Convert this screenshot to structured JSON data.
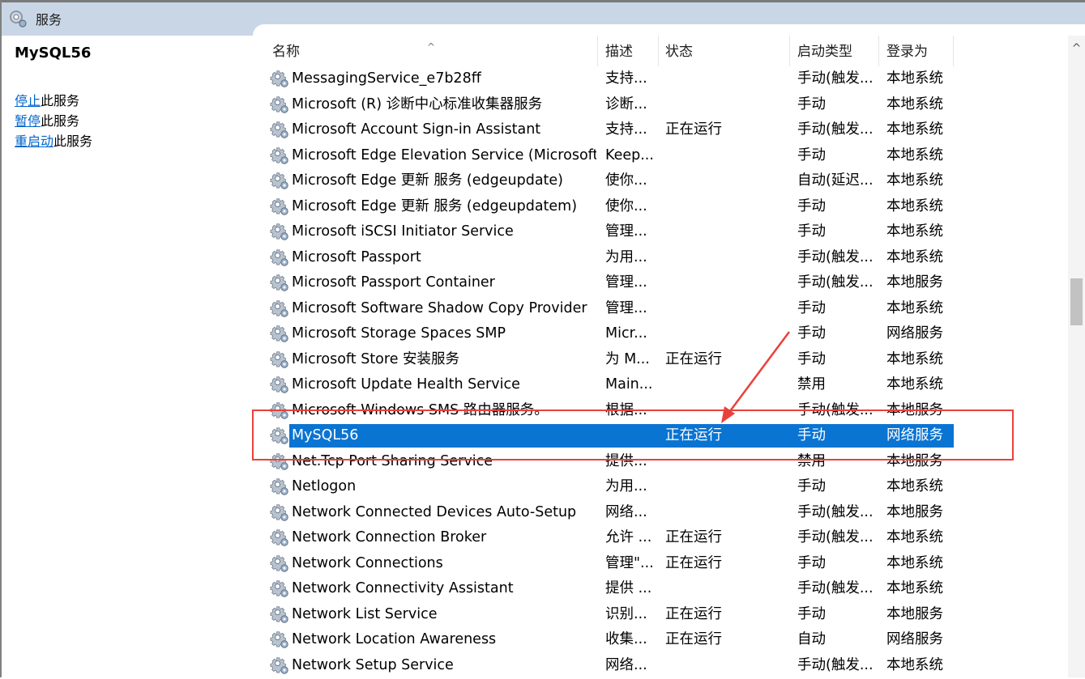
{
  "window": {
    "title": "服务"
  },
  "left_pane": {
    "service_name": "MySQL56",
    "actions": [
      {
        "link": "停止",
        "suffix": "此服务"
      },
      {
        "link": "暂停",
        "suffix": "此服务"
      },
      {
        "link": "重启动",
        "suffix": "此服务"
      }
    ]
  },
  "columns": {
    "name": "名称",
    "description": "描述",
    "status": "状态",
    "startup_type": "启动类型",
    "logon_as": "登录为"
  },
  "services": [
    {
      "name": "MessagingService_e7b28ff",
      "description": "支持...",
      "status": "",
      "startup_type": "手动(触发...",
      "logon_as": "本地系统"
    },
    {
      "name": "Microsoft (R) 诊断中心标准收集器服务",
      "description": "诊断...",
      "status": "",
      "startup_type": "手动",
      "logon_as": "本地系统"
    },
    {
      "name": "Microsoft Account Sign-in Assistant",
      "description": "支持...",
      "status": "正在运行",
      "startup_type": "手动(触发...",
      "logon_as": "本地系统"
    },
    {
      "name": "Microsoft Edge Elevation Service (MicrosoftE...",
      "description": "Keep...",
      "status": "",
      "startup_type": "手动",
      "logon_as": "本地系统"
    },
    {
      "name": "Microsoft Edge 更新 服务 (edgeupdate)",
      "description": "使你...",
      "status": "",
      "startup_type": "自动(延迟...",
      "logon_as": "本地系统"
    },
    {
      "name": "Microsoft Edge 更新 服务 (edgeupdatem)",
      "description": "使你...",
      "status": "",
      "startup_type": "手动",
      "logon_as": "本地系统"
    },
    {
      "name": "Microsoft iSCSI Initiator Service",
      "description": "管理...",
      "status": "",
      "startup_type": "手动",
      "logon_as": "本地系统"
    },
    {
      "name": "Microsoft Passport",
      "description": "为用...",
      "status": "",
      "startup_type": "手动(触发...",
      "logon_as": "本地系统"
    },
    {
      "name": "Microsoft Passport Container",
      "description": "管理...",
      "status": "",
      "startup_type": "手动(触发...",
      "logon_as": "本地服务"
    },
    {
      "name": "Microsoft Software Shadow Copy Provider",
      "description": "管理...",
      "status": "",
      "startup_type": "手动",
      "logon_as": "本地系统"
    },
    {
      "name": "Microsoft Storage Spaces SMP",
      "description": "Micr...",
      "status": "",
      "startup_type": "手动",
      "logon_as": "网络服务"
    },
    {
      "name": "Microsoft Store 安装服务",
      "description": "为 M...",
      "status": "正在运行",
      "startup_type": "手动",
      "logon_as": "本地系统"
    },
    {
      "name": "Microsoft Update Health Service",
      "description": "Main...",
      "status": "",
      "startup_type": "禁用",
      "logon_as": "本地系统"
    },
    {
      "name": "Microsoft Windows SMS 路由器服务。",
      "description": "根据...",
      "status": "",
      "startup_type": "手动(触发...",
      "logon_as": "本地服务"
    },
    {
      "name": "MySQL56",
      "description": "",
      "status": "正在运行",
      "startup_type": "手动",
      "logon_as": "网络服务",
      "selected": true
    },
    {
      "name": "Net.Tcp Port Sharing Service",
      "description": "提供...",
      "status": "",
      "startup_type": "禁用",
      "logon_as": "本地服务"
    },
    {
      "name": "Netlogon",
      "description": "为用...",
      "status": "",
      "startup_type": "手动",
      "logon_as": "本地系统"
    },
    {
      "name": "Network Connected Devices Auto-Setup",
      "description": "网络...",
      "status": "",
      "startup_type": "手动(触发...",
      "logon_as": "本地服务"
    },
    {
      "name": "Network Connection Broker",
      "description": "允许 ...",
      "status": "正在运行",
      "startup_type": "手动(触发...",
      "logon_as": "本地系统"
    },
    {
      "name": "Network Connections",
      "description": "管理\"...",
      "status": "正在运行",
      "startup_type": "手动",
      "logon_as": "本地系统"
    },
    {
      "name": "Network Connectivity Assistant",
      "description": "提供 ...",
      "status": "",
      "startup_type": "手动(触发...",
      "logon_as": "本地系统"
    },
    {
      "name": "Network List Service",
      "description": "识别...",
      "status": "正在运行",
      "startup_type": "手动",
      "logon_as": "本地服务"
    },
    {
      "name": "Network Location Awareness",
      "description": "收集...",
      "status": "正在运行",
      "startup_type": "自动",
      "logon_as": "网络服务"
    },
    {
      "name": "Network Setup Service",
      "description": "网络...",
      "status": "",
      "startup_type": "手动(触发...",
      "logon_as": "本地系统"
    }
  ],
  "colors": {
    "selection": "#0a74d2",
    "annotation": "#e8413a",
    "link": "#0066cc",
    "titlebar": "#c9d6e6"
  },
  "icons": {
    "row_icon": "gear-icon",
    "title_icon": "services-icon"
  }
}
